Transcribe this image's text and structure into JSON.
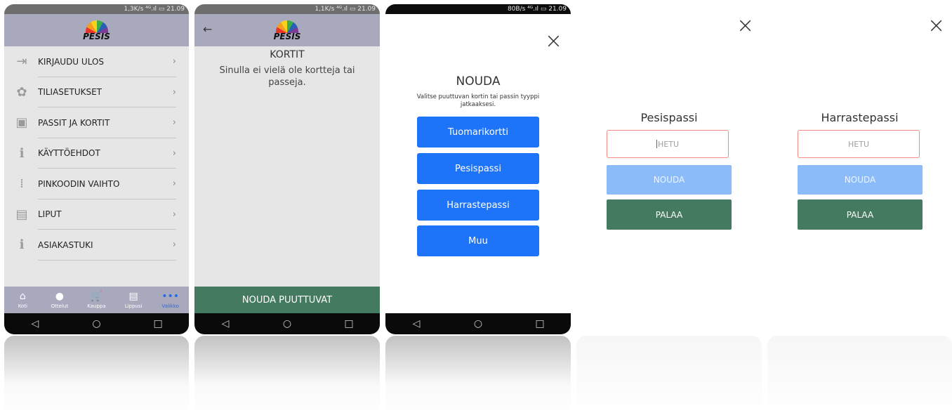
{
  "phone1": {
    "status": "1,3K/s ⁴ᴳ.ıl ▭ 21.09",
    "logo_text": "PESIS",
    "menu": [
      {
        "icon": "logout-icon",
        "glyph": "⇥",
        "label": "KIRJAUDU ULOS"
      },
      {
        "icon": "gear-icon",
        "glyph": "✿",
        "label": "TILIASETUKSET"
      },
      {
        "icon": "id-card-icon",
        "glyph": "▣",
        "label": "PASSIT JA KORTIT"
      },
      {
        "icon": "info-icon",
        "glyph": "ℹ",
        "label": "KÄYTTÖEHDOT"
      },
      {
        "icon": "keypad-icon",
        "glyph": "⁞",
        "label": "PINKOODIN VAIHTO"
      },
      {
        "icon": "ticket-icon",
        "glyph": "▤",
        "label": "LIPUT"
      },
      {
        "icon": "info-icon",
        "glyph": "ℹ",
        "label": "ASIAKASTUKI"
      }
    ],
    "chevron": "›",
    "tabs": [
      {
        "icon": "home-icon",
        "glyph": "⌂",
        "label": "Koti"
      },
      {
        "icon": "ball-icon",
        "glyph": "●",
        "label": "Ottelut"
      },
      {
        "icon": "cart-icon",
        "glyph": "🛒",
        "label": "Kauppa"
      },
      {
        "icon": "ticket-icon",
        "glyph": "▤",
        "label": "Lippusi"
      },
      {
        "icon": "more-icon",
        "glyph": "•••",
        "label": "Valikko"
      }
    ]
  },
  "phone2": {
    "status": "1,1K/s ⁴ᴳ.ıl ▭ 21.09",
    "logo_text": "PESIS",
    "title": "KORTIT",
    "message": "Sinulla ei vielä ole kortteja tai passeja.",
    "bottom_button": "NOUDA PUUTTUVAT"
  },
  "phone3": {
    "status": "80B/s ⁴ᴳ.ıl ▭ 21.09",
    "title": "NOUDA",
    "subtitle": "Valitse puuttuvan kortin tai passin tyyppi jatkaaksesi.",
    "buttons": [
      "Tuomarikortti",
      "Pesispassi",
      "Harrastepassi",
      "Muu"
    ]
  },
  "form1": {
    "title": "Pesispassi",
    "placeholder": "HETU",
    "fetch_label": "NOUDA",
    "back_label": "PALAA"
  },
  "form2": {
    "title": "Harrastepassi",
    "placeholder": "HETU",
    "fetch_label": "NOUDA",
    "back_label": "PALAA"
  },
  "nav": {
    "back": "◁",
    "home": "○",
    "recents": "□"
  },
  "close_glyph": "×",
  "back_arrow": "←",
  "colors": {
    "accent_blue": "#1e74f8",
    "green": "#447a5f",
    "header": "#a8a9bd",
    "light_blue": "#8bbcf9",
    "error_border": "#f08a84"
  }
}
